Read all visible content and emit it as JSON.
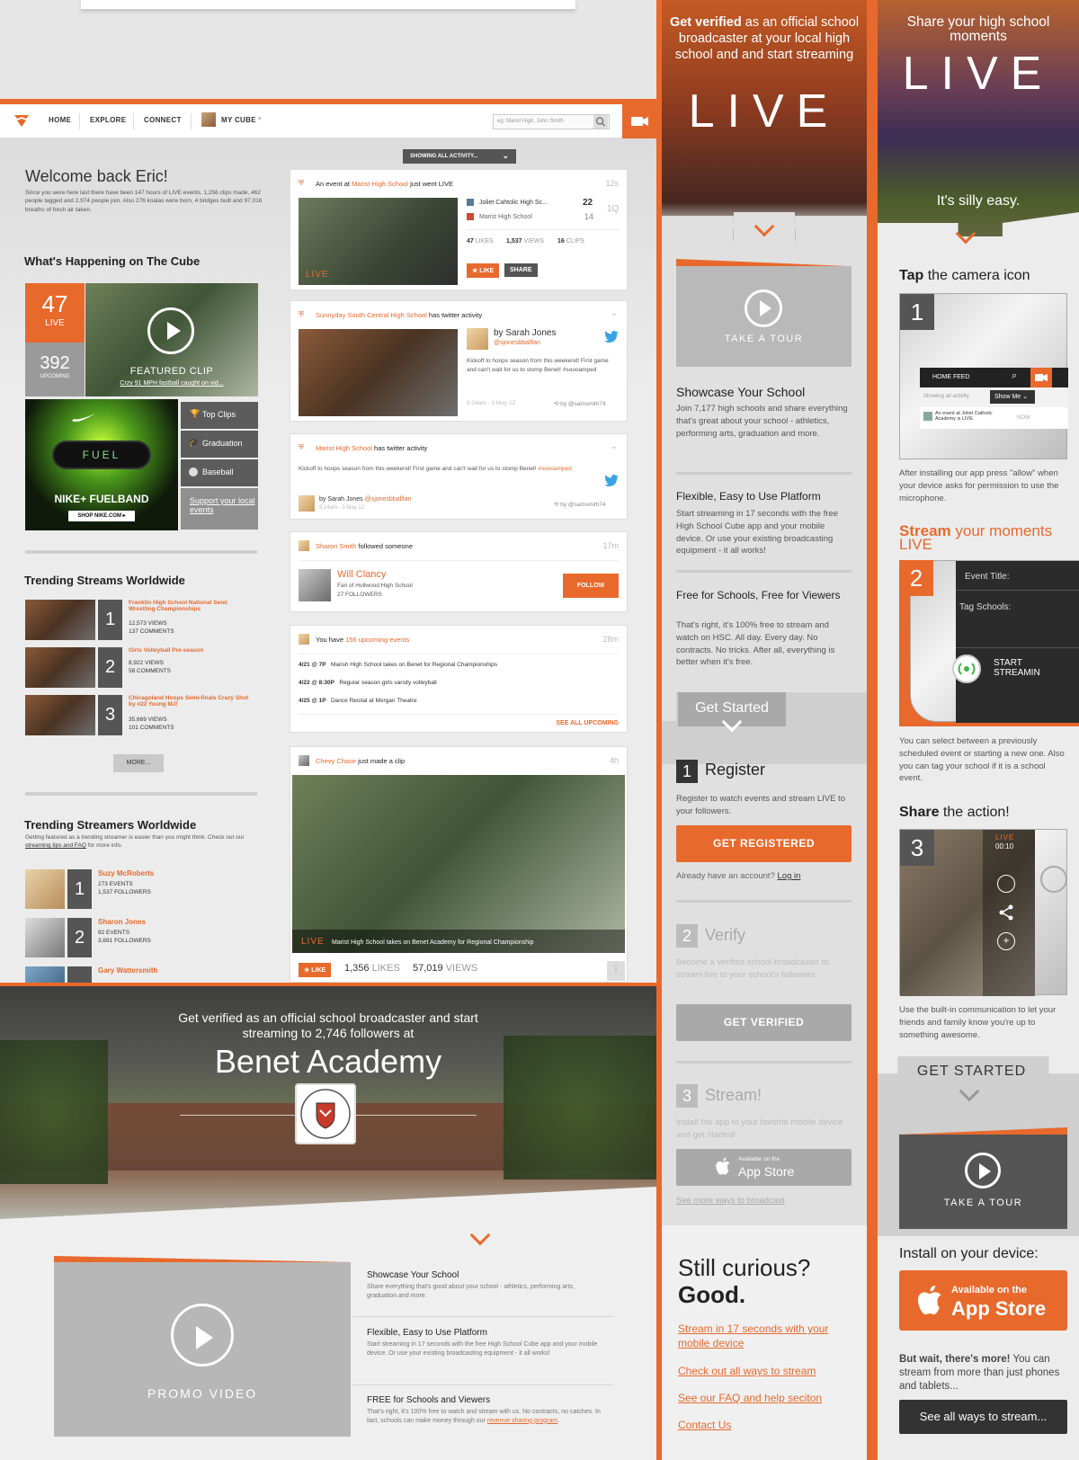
{
  "desktop": {
    "nav": {
      "home": "HOME",
      "explore": "EXPLORE",
      "connect": "CONNECT",
      "my_cube": "MY CUBE",
      "search_placeholder": "eg: Marist High, John Smith"
    },
    "showing_filter": "SHOWING ALL ACTIVITY...",
    "welcome": "Welcome back Eric!",
    "welcome_sub": "Since you were here last there have been 147 hours of LIVE events, 1,256 clips made, 462 people tagged and 2,974 people join. Also 276 koalas were born, 4 bridges built and 97,016 breaths of fresh air taken.",
    "happening_title": "What's Happening on The Cube",
    "live_count": "47",
    "live_label": "LIVE",
    "upcoming_count": "392",
    "upcoming_label": "UPCOMING",
    "featured_label": "FEATURED CLIP",
    "featured_caption": "Crzy 91 MPH fastball caught on vid...",
    "ad_fuel": "FUEL",
    "ad_title": "NIKE+ FUELBAND",
    "ad_shop": "SHOP NIKE.COM ▸",
    "side_links": [
      "Top Clips",
      "Graduation",
      "Baseball"
    ],
    "support_link": "Support your local events",
    "trending_title": "Trending Streams Worldwide",
    "trending": [
      {
        "rank": "1",
        "title": "Franklin High School National Semi Wrestling Championships",
        "views": "12,573 VIEWS",
        "comments": "137 COMMENTS"
      },
      {
        "rank": "2",
        "title": "Girls Volleyball Pre-season",
        "views": "8,922 VIEWS",
        "comments": "58 COMMENTS"
      },
      {
        "rank": "3",
        "title": "Chicagoland Hoops Semi-finals Crazy Shot by #22 Young MJ!",
        "views": "35,669 VIEWS",
        "comments": "101 COMMENTS"
      }
    ],
    "more": "MORE...",
    "streamers_title": "Trending Streamers Worldwide",
    "streamers_sub_a": "Getting featured as a trending streamer is easier than you might think. Check out our ",
    "streamers_sub_link": "streaming tips and FAQ",
    "streamers_sub_b": " for more info.",
    "streamers": [
      {
        "rank": "1",
        "name": "Suzy McRoberts",
        "events": "273 EVENTS",
        "followers": "1,537 FOLLOWERS"
      },
      {
        "rank": "2",
        "name": "Sharon Jones",
        "events": "92 EVENTS",
        "followers": "3,691 FOLLOWERS"
      },
      {
        "rank": "3",
        "name": "Gary Wattersmith",
        "events": "",
        "followers": ""
      }
    ],
    "feed": {
      "c1": {
        "pre": "An event at ",
        "school": "Marist High School",
        "post": " just went LIVE",
        "time": "12s",
        "team1": "Joliet Cahtolic High Sc...",
        "score1": "22",
        "team2": "Marist High School",
        "score2": "14",
        "quarter": "1Q",
        "likes_n": "47",
        "likes_l": "LIKES",
        "views_n": "1,537",
        "views_l": "VIEWS",
        "clips_n": "16",
        "clips_l": "CLIPS",
        "live": "LIVE",
        "like": "★ LIKE",
        "share": "SHARE"
      },
      "c2": {
        "school": "Sunnyday South Central High School",
        "post": " has twitter activity",
        "by": "by Sarah Jones",
        "handle": "@sjonesbballfan",
        "tweet": "Kickoff to hoops season from this weekend! First game and can't wait for us to stomp Benet! #soooamped",
        "date": "9:24am - 3 May 12",
        "rt": "by @samsmith74"
      },
      "c3": {
        "school": "Marist High School",
        "post": " has twitter activity",
        "tweet_a": "Kickoff to hoops season from this weekend! First game and can't wait for us to stomp Benet! ",
        "hashtag": "#soooamped",
        "by": "by Sarah Jones ",
        "handle": "@sjonesbballfan",
        "date": "9:24am - 3 May 12",
        "rt": "by @samsmith74"
      },
      "c4": {
        "name": "Sharon Smith",
        "post": " followed someone",
        "time": "17m",
        "who": "Will Clancy",
        "fan": "Fan of Hollwood High School",
        "followers": "27 FOLLOWERS",
        "follow": "FOLLOW"
      },
      "c5": {
        "pre": "You have ",
        "count": "156 upcoming events",
        "time": "28m",
        "events": [
          {
            "date": "4/21 @ 7P",
            "text": "Marish High School takes on Benet for Regional Championships"
          },
          {
            "date": "4/22 @ 8:30P",
            "text": "Regular season girls varsity volleyball"
          },
          {
            "date": "4/25 @ 1P",
            "text": "Dance Recital at Morgan Theatre"
          }
        ],
        "see_all": "SEE ALL UPCOMING"
      },
      "c6": {
        "name": "Chevy Chase",
        "post": " just made a clip",
        "time": "4h",
        "live": "LIVE",
        "caption": "Marist High School takes on Benet Academy for Regional Championship",
        "like": "★ LIKE",
        "likes_n": "1,356",
        "likes_l": "LIKES",
        "views_n": "57,019",
        "views_l": "VIEWS"
      }
    }
  },
  "landing": {
    "headline": "Get verified as an official school broadcaster and start streaming to 2,746 followers at",
    "school": "Benet Academy",
    "promo": "PROMO VIDEO",
    "features": [
      {
        "title": "Showcase Your School",
        "text": "Share everything that's good about your school - athletics, performing arts, graduation and more."
      },
      {
        "title": "Flexible, Easy to Use Platform",
        "text": "Start streaming in 17 seconds with the free High School Cube app and your mobile device. Or use your existing broadcasting equipment - it all works!"
      },
      {
        "title": "FREE for Schools and Viewers",
        "text": "That's right, it's 100% free to watch and stream with us. No contracts, no catches. In fact, schools can make money through our ",
        "link": "revenue sharing program",
        "end": "."
      }
    ]
  },
  "col1": {
    "hero_a": "Get verified",
    "hero_b": " as an official school broadcaster at your local high school and and start streaming",
    "live_word": "LIVE",
    "tour": "TAKE A TOUR",
    "features": [
      {
        "title": "Showcase Your School",
        "text": "Join 7,177 high schools and share everything that's great about your school - athletics, performing arts, graduation and more."
      },
      {
        "title": "Flexible, Easy to Use Platform",
        "text": "Start streaming in 17 seconds with the free High School Cube app and your mobile device. Or use your existing broadcasting equipment - it all works!"
      },
      {
        "title": "Free for Schools, Free for Viewers",
        "text": "That's right, it's 100% free to stream and watch on HSC. All day. Every day. No contracts. No tricks. After all, everything is better when it's free."
      }
    ],
    "get_started": "Get Started",
    "steps": [
      {
        "num": "1",
        "title": "Register",
        "text": "Register to watch events and stream LIVE to your followers.",
        "button": "GET REGISTERED"
      },
      {
        "num": "2",
        "title": "Verify",
        "text": "Become a verified school broadcaster to stream live to your school's followers.",
        "button": "GET VERIFIED"
      },
      {
        "num": "3",
        "title": "Stream!",
        "text": "Install the app to your favorite mobile device and get started!"
      }
    ],
    "account_q": "Already have an account? ",
    "login": "Log in",
    "avail": "Available on the",
    "appstore": "App Store",
    "more_ways": "See more ways to broadcast",
    "curious": "Still curious?",
    "good": "Good.",
    "links": [
      "Stream in 17 seconds with your mobile device",
      "Check out all ways to stream",
      "See our FAQ and help seciton",
      "Contact Us"
    ]
  },
  "col2": {
    "hero": "Share your high school moments",
    "live_word": "LIVE",
    "easy": "It's silly easy.",
    "tap_a": "Tap",
    "tap_b": " the camera icon",
    "phone1_feed": "HOME FEED",
    "phone1_showing": "Showing all activity",
    "phone1_showme": "Show Me",
    "phone1_event": "An event at Joliet Catholic Academy is LIVE",
    "phone1_now": "NOW",
    "step1_text": "After installing our app press \"allow\" when your device asks for permission to use the microphone.",
    "stream_a": "Stream",
    "stream_b": " your moments LIVE",
    "phone2_title": "Event Title:",
    "phone2_tag": "Tag Schools:",
    "phone2_start": "START STREAMIN",
    "step2_text": "You can select between a previously scheduled event or starting a new one. Also you can tag your school if it is a school event.",
    "share_a": "Share",
    "share_b": " the action!",
    "phone3_live": "LIVE",
    "phone3_time": "00:10",
    "step3_text": "Use the built-in communication to let your friends and family know you're up to something awesome.",
    "get_started": "GET STARTED",
    "tour": "TAKE A TOUR",
    "install": "Install on your device:",
    "avail": "Available on the",
    "appstore": "App Store",
    "more_a": "But wait, there's more!",
    "more_b": " You can stream from more than just phones and tablets...",
    "see_all": "See all ways to stream..."
  }
}
